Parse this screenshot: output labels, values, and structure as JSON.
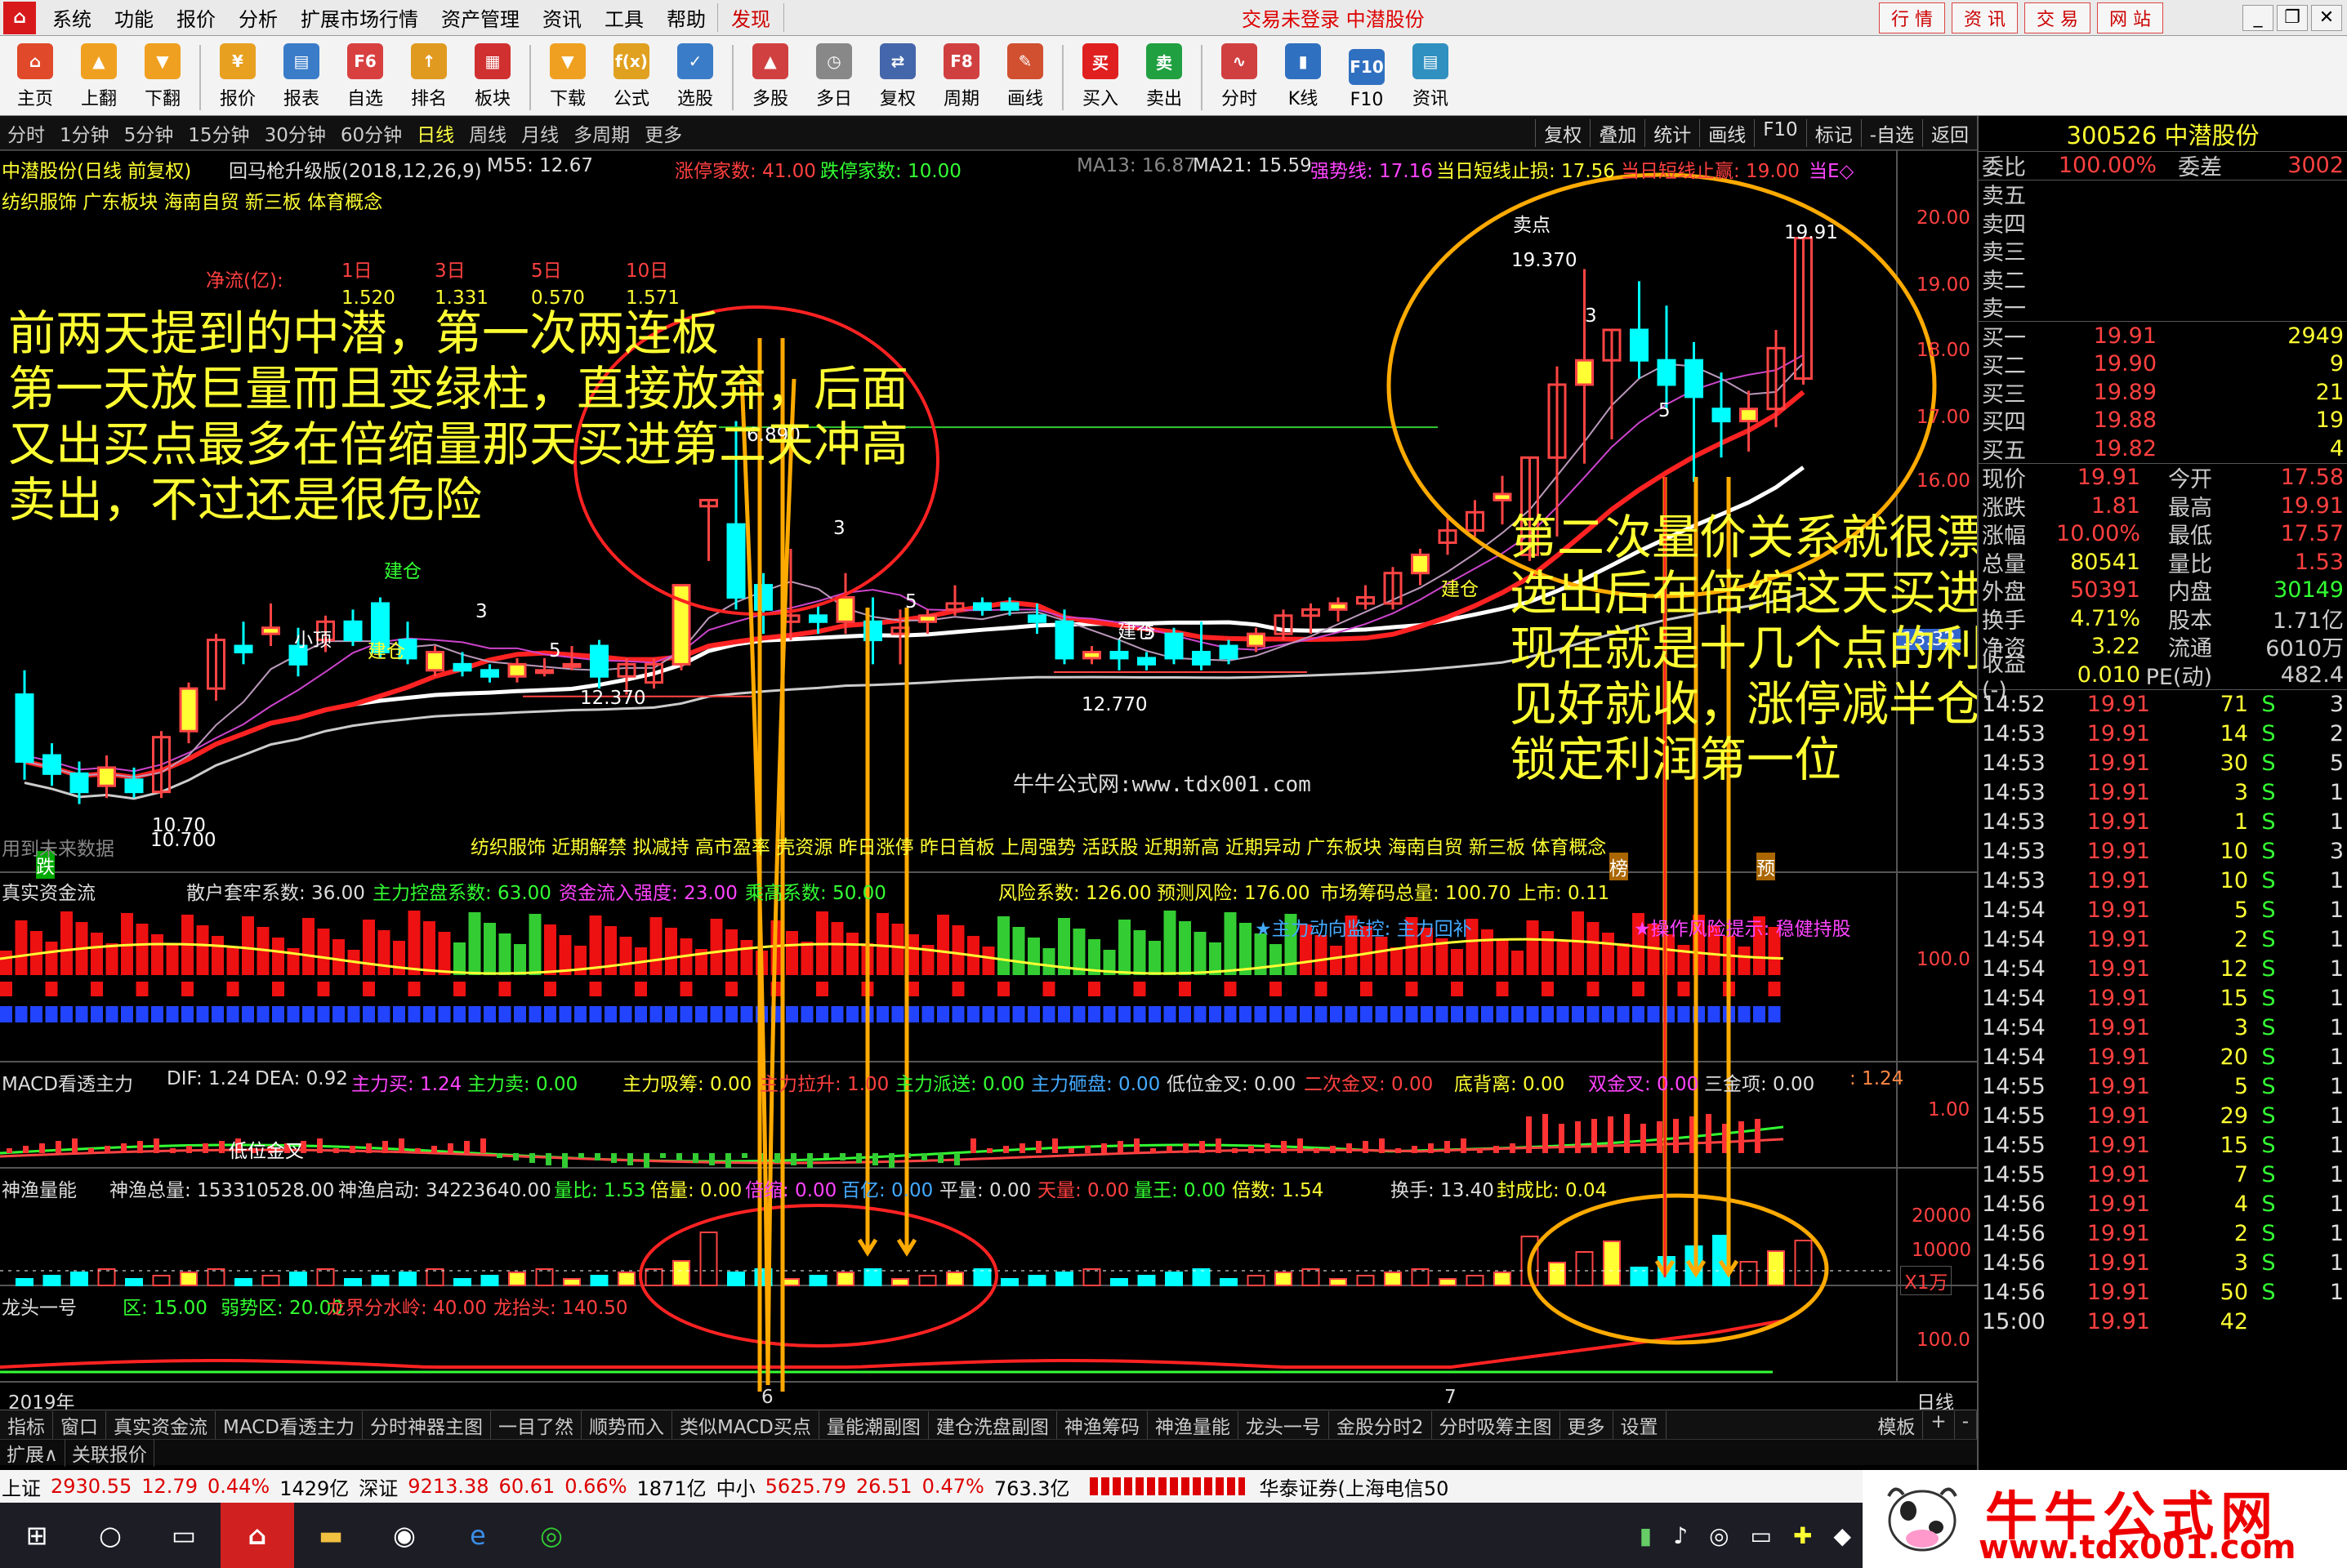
{
  "menu": {
    "items": [
      "系统",
      "功能",
      "报价",
      "分析",
      "扩展市场行情",
      "资产管理",
      "资讯",
      "工具",
      "帮助"
    ],
    "discover": "发现",
    "center_text": "交易未登录 中潜股份",
    "right_tabs": [
      "行 情",
      "资 讯",
      "交 易",
      "网 站"
    ],
    "window_controls": [
      "_",
      "❐",
      "✕"
    ]
  },
  "toolbar": [
    {
      "label": "主页",
      "icon": "home-icon",
      "color": "#e04a2a"
    },
    {
      "label": "上翻",
      "icon": "arrow-up-icon",
      "color": "#f0a020"
    },
    {
      "label": "下翻",
      "icon": "arrow-down-icon",
      "color": "#f0a020"
    },
    {
      "label": "报价",
      "icon": "yen-icon",
      "color": "#e8a020"
    },
    {
      "label": "报表",
      "icon": "report-icon",
      "color": "#3a7cc8"
    },
    {
      "label": "自选",
      "icon": "f6-icon",
      "color": "#d84040"
    },
    {
      "label": "排名",
      "icon": "ranking-icon",
      "color": "#e09a20"
    },
    {
      "label": "板块",
      "icon": "sector-icon",
      "color": "#d03030"
    },
    {
      "label": "下载",
      "icon": "download-icon",
      "color": "#f0a020"
    },
    {
      "label": "公式",
      "icon": "formula-icon",
      "color": "#e0a020"
    },
    {
      "label": "选股",
      "icon": "stock-picker-icon",
      "color": "#3a7cc8"
    },
    {
      "label": "多股",
      "icon": "multi-stock-icon",
      "color": "#d04040"
    },
    {
      "label": "多日",
      "icon": "clock-icon",
      "color": "#888888"
    },
    {
      "label": "复权",
      "icon": "restore-rights-icon",
      "color": "#4466aa"
    },
    {
      "label": "周期",
      "icon": "f8-icon",
      "color": "#d04040"
    },
    {
      "label": "画线",
      "icon": "draw-line-icon",
      "color": "#d05030"
    },
    {
      "label": "买入",
      "icon": "buy-icon",
      "color": "#e02020"
    },
    {
      "label": "卖出",
      "icon": "sell-icon",
      "color": "#20a040"
    },
    {
      "label": "分时",
      "icon": "intraday-icon",
      "color": "#d04040"
    },
    {
      "label": "K线",
      "icon": "kline-icon",
      "color": "#3070c0"
    },
    {
      "label": "F10",
      "icon": "f10-icon",
      "color": "#3070c0"
    },
    {
      "label": "资讯",
      "icon": "news-icon",
      "color": "#3090c0"
    }
  ],
  "toolbar_icon_text": {
    "主页": "⌂",
    "上翻": "▲",
    "下翻": "▼",
    "报价": "¥",
    "报表": "▤",
    "自选": "F6",
    "排名": "↑",
    "板块": "▦",
    "下载": "▼",
    "公式": "f(x)",
    "选股": "✓",
    "多股": "▲",
    "多日": "◷",
    "复权": "⇄",
    "周期": "F8",
    "画线": "✎",
    "买入": "买",
    "卖出": "卖",
    "分时": "∿",
    "K线": "▮",
    "F10": "F10",
    "资讯": "▤"
  },
  "periods": [
    "分时",
    "1分钟",
    "5分钟",
    "15分钟",
    "30分钟",
    "60分钟",
    "日线",
    "周线",
    "月线",
    "多周期",
    "更多"
  ],
  "active_period": "日线",
  "period_right": [
    "复权",
    "叠加",
    "统计",
    "画线",
    "F10",
    "标记",
    "-自选",
    "返回"
  ],
  "main_header": {
    "name": "中潜股份(日线 前复权)",
    "formula": "回马枪升级版(2018,12,26,9)",
    "m55": "M55: 12.67",
    "up_limit": "涨停家数: 41.00",
    "down_limit": "跌停家数: 10.00",
    "ma13": "MA13: 16.87",
    "ma21": "MA21: 15.59",
    "strong": "强势线: 17.16",
    "stop_loss": "当日短线止损: 17.56",
    "take_profit": "当日短线止赢: 19.00",
    "last": "当E◇",
    "concepts": "纺织服饰 广东板块 海南自贸 新三板 体育概念"
  },
  "netflow": {
    "label": "净流(亿):",
    "headers": [
      "1日",
      "3日",
      "5日",
      "10日"
    ],
    "values": [
      "1.520",
      "1.331",
      "0.570",
      "1.571"
    ]
  },
  "main_labels": {
    "sell_point": "卖点",
    "high1": "19.370",
    "high2": "19.91",
    "p890": "6.890",
    "low1": "12.370",
    "low2": "12.770",
    "low3": "10.70",
    "low3b": "10.700",
    "xiaoding": "小顶",
    "jiancang1": "建仓",
    "jiancang2": "建仓",
    "jiancang3": "建仓",
    "jiancang4": "建仓",
    "n3a": "3",
    "n3b": "3",
    "n3c": "3",
    "n5a": "5",
    "n5b": "5",
    "n5c": "5",
    "n5d": "5",
    "diee": "跌",
    "bang": "榜",
    "yu": "预",
    "future": "用到未来数据",
    "price_box": "13.32",
    "bottom_concepts": "纺织服饰 近期解禁 拟减持 高市盈率 壳资源 昨日涨停 昨日首板 上周强势 活跃股 近期新高 近期异动 广东板块 海南自贸 新三板 体育概念"
  },
  "annotation_left": "前两天提到的中潜，第一次两连板\n第一天放巨量而且变绿柱，直接放弃，后面\n又出买点最多在倍缩量那天买进第二天冲高\n卖出，不过还是很危险",
  "annotation_right": "第二次量价关系就很漂亮了，\n选出后在倍缩这天买进，\n现在就是十几个点的利润了，\n见好就收，涨停减半仓，\n锁定利润第一位",
  "watermark": "牛牛公式网:www.tdx001.com",
  "price_axis": [
    "20.00",
    "19.00",
    "18.00",
    "17.00",
    "16.00"
  ],
  "ind1": {
    "name": "真实资金流",
    "sanhu": "散户套牢系数: 36.00",
    "zhukong": "主力控盘系数: 63.00",
    "inflow": "资金流入强度: 23.00",
    "chenggao": "乘高系数: 50.00",
    "risk": "风险系数: 126.00",
    "predict": "预测风险: 176.00",
    "chips": "市场筹码总量: 100.70",
    "market": "上市: 0.11",
    "monitor": "★主力动向监控: 主力回补",
    "operate": "★操作风险提示: 稳健持股",
    "axis": "100.0"
  },
  "ind2": {
    "name": "MACD看透主力",
    "dif": "DIF: 1.24",
    "dea": "DEA: 0.92",
    "buy": "主力买: 1.24",
    "sell": "主力卖: 0.00",
    "absorb": "主力吸筹: 0.00",
    "pull": "主力拉升: 1.00",
    "send": "主力派送: 0.00",
    "dump": "主力砸盘: 0.00",
    "low_gold": "低位金叉: 0.00",
    "second_gold": "二次金叉: 0.00",
    "bottom_div": "底背离: 0.00",
    "double_gold": "双金叉: 0.00",
    "three_top": "三金项: 0.00",
    "tail": ": 1.24",
    "axis": "1.00",
    "label": "低位金叉"
  },
  "ind3": {
    "name": "神渔量能",
    "total": "神渔总量: 153310528.00",
    "start": "神渔启动: 34223640.00",
    "ratio": "量比: 1.53",
    "double": "倍量: 0.00",
    "shrink": "倍缩: 0.00",
    "hundred": "百亿: 0.00",
    "flat": "平量: 0.00",
    "sky": "天量: 0.00",
    "star": "量王: 0.00",
    "multiple": "倍数: 1.54",
    "turnover": "换手: 13.40",
    "seal": "封成比: 0.04",
    "axis": [
      "20000",
      "10000",
      "X1万"
    ]
  },
  "ind4": {
    "name": "龙头一号",
    "zone": "区: 15.00",
    "weak": "弱势区: 20.00",
    "watershed": "龙界分水岭: 40.00",
    "dragon": "龙抬头: 140.50",
    "axis": "100.0"
  },
  "dates": {
    "year": "2019年",
    "m1": "6",
    "m2": "7",
    "period": "日线"
  },
  "bottom_tabs": [
    "指标",
    "窗口",
    "真实资金流",
    "MACD看透主力",
    "分时神器主图",
    "一目了然",
    "顺势而入",
    "类似MACD买点",
    "量能潮副图",
    "建仓洗盘副图",
    "神渔筹码",
    "神渔量能",
    "龙头一号",
    "金股分时2",
    "分时吸筹主图",
    "更多",
    "设置"
  ],
  "bottom_right": [
    "模板",
    "+",
    "-"
  ],
  "sub_tabs": [
    "扩展∧",
    "关联报价"
  ],
  "index_bar": {
    "sh": "上证",
    "sh_v": "2930.55",
    "sh_c": "12.79",
    "sh_p": "0.44%",
    "sh_a": "1429亿",
    "sz": "深证",
    "sz_v": "9213.38",
    "sz_c": "60.61",
    "sz_p": "0.66%",
    "sz_a": "1871亿",
    "zx": "中小",
    "zx_v": "5625.79",
    "zx_c": "26.51",
    "zx_p": "0.47%",
    "zx_a": "763.3亿",
    "broker": "华泰证券(上海电信50"
  },
  "logo": {
    "title": "牛牛公式网",
    "url": "www.tdx001.com"
  },
  "quote": {
    "code_name": "300526 中潜股份",
    "weibi": [
      "委比",
      "100.00%",
      "委差",
      "3002"
    ],
    "asks": [
      {
        "l": "卖五"
      },
      {
        "l": "卖四"
      },
      {
        "l": "卖三"
      },
      {
        "l": "卖二"
      },
      {
        "l": "卖一"
      }
    ],
    "bids": [
      {
        "l": "买一",
        "p": "19.91",
        "v": "2949"
      },
      {
        "l": "买二",
        "p": "19.90",
        "v": "9"
      },
      {
        "l": "买三",
        "p": "19.89",
        "v": "21"
      },
      {
        "l": "买四",
        "p": "19.88",
        "v": "19"
      },
      {
        "l": "买五",
        "p": "19.82",
        "v": "4"
      }
    ],
    "stats": [
      {
        "a": "现价",
        "b": "19.91",
        "c": "今开",
        "d": "17.58"
      },
      {
        "a": "涨跌",
        "b": "1.81",
        "c": "最高",
        "d": "19.91"
      },
      {
        "a": "涨幅",
        "b": "10.00%",
        "c": "最低",
        "d": "17.57"
      },
      {
        "a": "总量",
        "b": "80541",
        "c": "量比",
        "d": "1.53"
      },
      {
        "a": "外盘",
        "b": "50391",
        "c": "内盘",
        "d": "30149"
      },
      {
        "a": "换手",
        "b": "4.71%",
        "c": "股本",
        "d": "1.71亿"
      },
      {
        "a": "净资",
        "b": "3.22",
        "c": "流通",
        "d": "6010万"
      },
      {
        "a": "收益(-)",
        "b": "0.010",
        "c": "PE(动)",
        "d": "482.4"
      }
    ],
    "ticks": [
      {
        "t": "14:52",
        "p": "19.91",
        "v": "71",
        "s": "S",
        "n": "3"
      },
      {
        "t": "14:53",
        "p": "19.91",
        "v": "14",
        "s": "S",
        "n": "2"
      },
      {
        "t": "14:53",
        "p": "19.91",
        "v": "30",
        "s": "S",
        "n": "5"
      },
      {
        "t": "14:53",
        "p": "19.91",
        "v": "3",
        "s": "S",
        "n": "1"
      },
      {
        "t": "14:53",
        "p": "19.91",
        "v": "1",
        "s": "S",
        "n": "1"
      },
      {
        "t": "14:53",
        "p": "19.91",
        "v": "10",
        "s": "S",
        "n": "3"
      },
      {
        "t": "14:53",
        "p": "19.91",
        "v": "10",
        "s": "S",
        "n": "1"
      },
      {
        "t": "14:54",
        "p": "19.91",
        "v": "5",
        "s": "S",
        "n": "1"
      },
      {
        "t": "14:54",
        "p": "19.91",
        "v": "2",
        "s": "S",
        "n": "1"
      },
      {
        "t": "14:54",
        "p": "19.91",
        "v": "12",
        "s": "S",
        "n": "1"
      },
      {
        "t": "14:54",
        "p": "19.91",
        "v": "15",
        "s": "S",
        "n": "1"
      },
      {
        "t": "14:54",
        "p": "19.91",
        "v": "3",
        "s": "S",
        "n": "1"
      },
      {
        "t": "14:54",
        "p": "19.91",
        "v": "20",
        "s": "S",
        "n": "1"
      },
      {
        "t": "14:55",
        "p": "19.91",
        "v": "5",
        "s": "S",
        "n": "1"
      },
      {
        "t": "14:55",
        "p": "19.91",
        "v": "29",
        "s": "S",
        "n": "1"
      },
      {
        "t": "14:55",
        "p": "19.91",
        "v": "15",
        "s": "S",
        "n": "1"
      },
      {
        "t": "14:55",
        "p": "19.91",
        "v": "7",
        "s": "S",
        "n": "1"
      },
      {
        "t": "14:56",
        "p": "19.91",
        "v": "4",
        "s": "S",
        "n": "1"
      },
      {
        "t": "14:56",
        "p": "19.91",
        "v": "2",
        "s": "S",
        "n": "1"
      },
      {
        "t": "14:56",
        "p": "19.91",
        "v": "3",
        "s": "S",
        "n": "1"
      },
      {
        "t": "14:56",
        "p": "19.91",
        "v": "50",
        "s": "S",
        "n": "1"
      },
      {
        "t": "15:00",
        "p": "19.91",
        "v": "42",
        "s": "",
        "n": ""
      }
    ]
  },
  "chart_data": {
    "type": "candlestick",
    "title": "中潜股份(日线 前复权)",
    "ylim": [
      10.5,
      20.2
    ],
    "candles": [
      {
        "o": 12.4,
        "h": 12.8,
        "l": 11.0,
        "c": 11.3
      },
      {
        "o": 11.4,
        "h": 11.6,
        "l": 10.9,
        "c": 11.1
      },
      {
        "o": 11.1,
        "h": 11.3,
        "l": 10.6,
        "c": 10.8
      },
      {
        "o": 10.9,
        "h": 11.4,
        "l": 10.7,
        "c": 11.2
      },
      {
        "o": 11.0,
        "h": 11.2,
        "l": 10.7,
        "c": 10.8
      },
      {
        "o": 10.8,
        "h": 11.8,
        "l": 10.7,
        "c": 11.7
      },
      {
        "o": 11.8,
        "h": 12.6,
        "l": 11.6,
        "c": 12.5
      },
      {
        "o": 12.5,
        "h": 13.4,
        "l": 12.3,
        "c": 13.3
      },
      {
        "o": 13.2,
        "h": 13.6,
        "l": 12.9,
        "c": 13.1
      },
      {
        "o": 13.4,
        "h": 13.9,
        "l": 13.2,
        "c": 13.5
      },
      {
        "o": 13.2,
        "h": 13.5,
        "l": 12.7,
        "c": 12.9
      },
      {
        "o": 13.3,
        "h": 13.7,
        "l": 13.1,
        "c": 13.6
      },
      {
        "o": 13.6,
        "h": 13.8,
        "l": 13.2,
        "c": 13.3
      },
      {
        "o": 13.9,
        "h": 14.0,
        "l": 13.0,
        "c": 13.1
      },
      {
        "o": 13.3,
        "h": 13.6,
        "l": 12.9,
        "c": 13.0
      },
      {
        "o": 12.8,
        "h": 13.2,
        "l": 12.7,
        "c": 13.1
      },
      {
        "o": 12.9,
        "h": 13.1,
        "l": 12.7,
        "c": 12.8
      },
      {
        "o": 12.8,
        "h": 12.9,
        "l": 12.6,
        "c": 12.7
      },
      {
        "o": 12.7,
        "h": 13.0,
        "l": 12.6,
        "c": 12.9
      },
      {
        "o": 12.8,
        "h": 13.0,
        "l": 12.7,
        "c": 12.8
      },
      {
        "o": 12.9,
        "h": 13.2,
        "l": 12.8,
        "c": 12.9
      },
      {
        "o": 13.2,
        "h": 13.3,
        "l": 12.5,
        "c": 12.7
      },
      {
        "o": 12.7,
        "h": 13.0,
        "l": 12.4,
        "c": 12.9
      },
      {
        "o": 12.6,
        "h": 13.0,
        "l": 12.5,
        "c": 12.9
      },
      {
        "o": 12.9,
        "h": 14.2,
        "l": 12.8,
        "c": 14.2
      },
      {
        "o": 15.5,
        "h": 15.6,
        "l": 14.6,
        "c": 15.6
      },
      {
        "o": 15.2,
        "h": 16.9,
        "l": 13.8,
        "c": 14.0
      },
      {
        "o": 14.2,
        "h": 14.4,
        "l": 13.4,
        "c": 13.8
      },
      {
        "o": 13.6,
        "h": 14.8,
        "l": 13.3,
        "c": 13.7
      },
      {
        "o": 13.7,
        "h": 13.9,
        "l": 13.4,
        "c": 13.6
      },
      {
        "o": 13.6,
        "h": 14.4,
        "l": 13.4,
        "c": 14.0
      },
      {
        "o": 13.6,
        "h": 14.0,
        "l": 12.9,
        "c": 13.3
      },
      {
        "o": 13.4,
        "h": 13.8,
        "l": 12.9,
        "c": 13.5
      },
      {
        "o": 13.6,
        "h": 13.8,
        "l": 13.4,
        "c": 13.7
      },
      {
        "o": 13.8,
        "h": 14.2,
        "l": 13.7,
        "c": 13.9
      },
      {
        "o": 13.9,
        "h": 14.0,
        "l": 13.7,
        "c": 13.8
      },
      {
        "o": 13.9,
        "h": 14.0,
        "l": 13.7,
        "c": 13.8
      },
      {
        "o": 13.7,
        "h": 13.9,
        "l": 13.4,
        "c": 13.6
      },
      {
        "o": 13.6,
        "h": 13.8,
        "l": 12.9,
        "c": 13.0
      },
      {
        "o": 13.0,
        "h": 13.2,
        "l": 12.9,
        "c": 13.1
      },
      {
        "o": 13.1,
        "h": 13.3,
        "l": 12.8,
        "c": 13.0
      },
      {
        "o": 13.0,
        "h": 13.1,
        "l": 12.8,
        "c": 12.9
      },
      {
        "o": 13.4,
        "h": 13.5,
        "l": 12.9,
        "c": 13.0
      },
      {
        "o": 13.1,
        "h": 13.6,
        "l": 12.8,
        "c": 12.9
      },
      {
        "o": 13.2,
        "h": 13.3,
        "l": 12.9,
        "c": 13.0
      },
      {
        "o": 13.2,
        "h": 13.5,
        "l": 13.1,
        "c": 13.4
      },
      {
        "o": 13.4,
        "h": 13.8,
        "l": 13.3,
        "c": 13.7
      },
      {
        "o": 13.7,
        "h": 13.9,
        "l": 13.4,
        "c": 13.8
      },
      {
        "o": 13.8,
        "h": 14.0,
        "l": 13.6,
        "c": 13.9
      },
      {
        "o": 13.9,
        "h": 14.2,
        "l": 13.8,
        "c": 14.0
      },
      {
        "o": 13.9,
        "h": 14.5,
        "l": 13.8,
        "c": 14.4
      },
      {
        "o": 14.4,
        "h": 14.8,
        "l": 14.2,
        "c": 14.7
      },
      {
        "o": 14.9,
        "h": 15.3,
        "l": 14.7,
        "c": 15.1
      },
      {
        "o": 15.1,
        "h": 15.6,
        "l": 15.0,
        "c": 15.4
      },
      {
        "o": 15.6,
        "h": 16.0,
        "l": 15.2,
        "c": 15.7
      },
      {
        "o": 14.7,
        "h": 16.3,
        "l": 14.6,
        "c": 16.3
      },
      {
        "o": 16.3,
        "h": 17.8,
        "l": 15.0,
        "c": 17.5
      },
      {
        "o": 17.5,
        "h": 19.4,
        "l": 16.2,
        "c": 17.9
      },
      {
        "o": 17.9,
        "h": 18.4,
        "l": 16.6,
        "c": 18.4
      },
      {
        "o": 18.4,
        "h": 19.2,
        "l": 17.6,
        "c": 17.9
      },
      {
        "o": 17.9,
        "h": 18.8,
        "l": 17.1,
        "c": 17.5
      },
      {
        "o": 17.9,
        "h": 18.2,
        "l": 15.9,
        "c": 17.3
      },
      {
        "o": 17.1,
        "h": 17.7,
        "l": 16.3,
        "c": 16.9
      },
      {
        "o": 16.9,
        "h": 17.4,
        "l": 16.4,
        "c": 17.1
      },
      {
        "o": 17.1,
        "h": 18.4,
        "l": 16.8,
        "c": 18.1
      },
      {
        "o": 17.6,
        "h": 19.9,
        "l": 17.5,
        "c": 19.91
      }
    ]
  }
}
